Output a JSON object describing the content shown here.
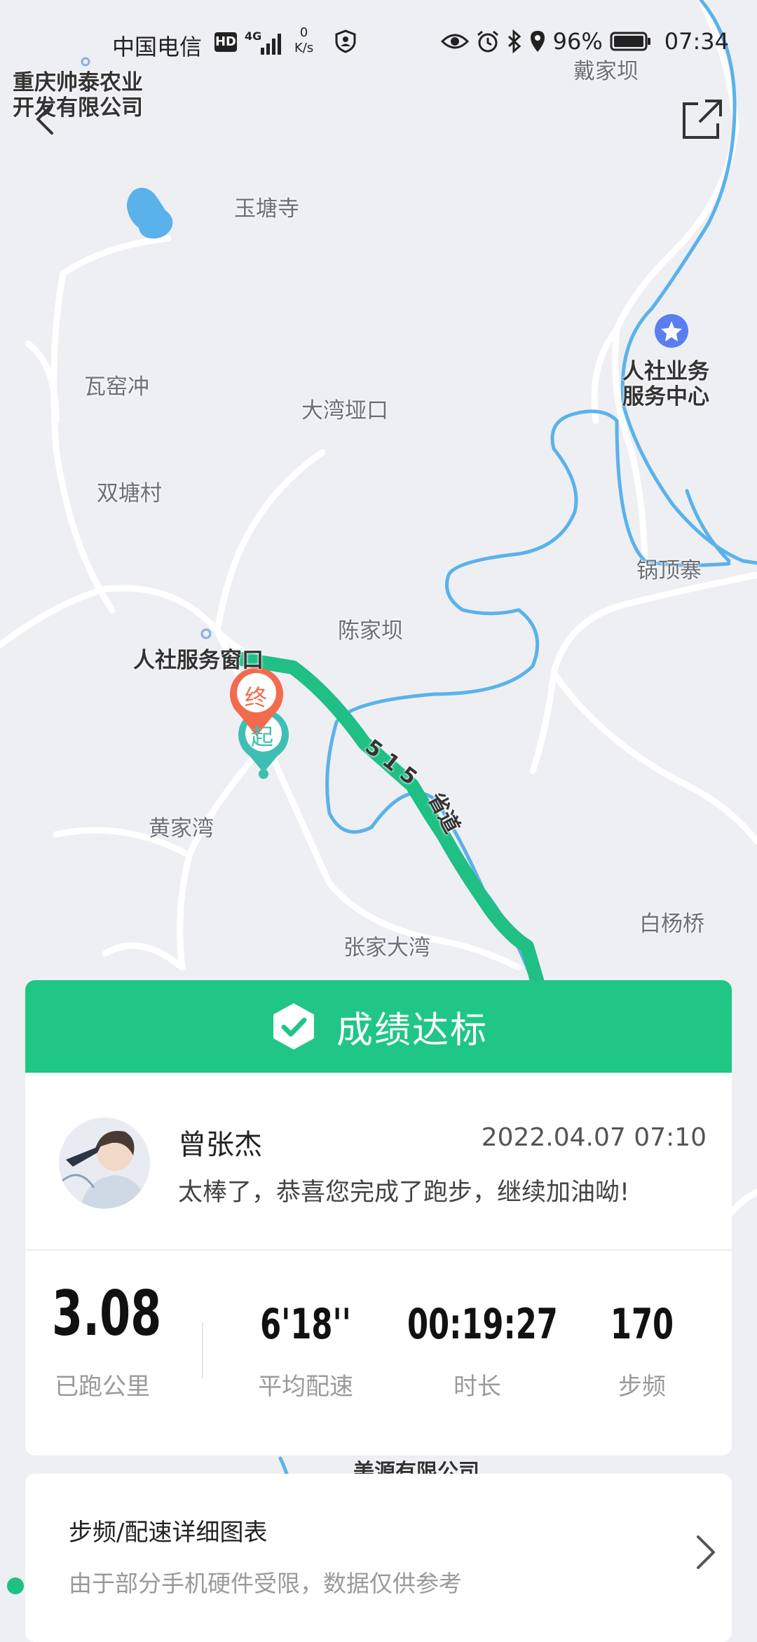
{
  "status_bar": {
    "carrier": "中国电信",
    "hd": "HD",
    "network": "4G",
    "speed_value": "0",
    "speed_unit": "K/s",
    "battery": "96%",
    "time": "07:34"
  },
  "map": {
    "labels": {
      "company": "重庆帅泰农业\n开发有限公司",
      "daijiaba": "戴家坝",
      "yutangsi": "玉塘寺",
      "waoyaochong": "瓦窑冲",
      "dawanyakou": "大湾垭口",
      "shuangtangcun": "双塘村",
      "renshe_center": "人社业务\n服务中心",
      "guodingzhai": "锅顶寨",
      "chenjiaba": "陈家坝",
      "renshe_window": "人社服务窗口",
      "huangjiawan": "黄家湾",
      "baiyangqiao": "白杨桥",
      "zhangjiadawan": "张家大湾",
      "road_number": "5 1 5",
      "road_name": "省道",
      "partial_company": "美源有限公司"
    },
    "markers": {
      "end": "终",
      "start": "起"
    },
    "colors": {
      "route": "#1fbf85",
      "river": "#5ab2ea",
      "road": "#ffffff",
      "land": "#eeeff3"
    }
  },
  "result": {
    "title": "成绩达标",
    "user_name": "曾张杰",
    "datetime": "2022.04.07 07:10",
    "message": "太棒了，恭喜您完成了跑步，继续加油呦!",
    "stats": [
      {
        "value": "3.08",
        "label": "已跑公里"
      },
      {
        "value": "6'18''",
        "label": "平均配速"
      },
      {
        "value": "00:19:27",
        "label": "时长"
      },
      {
        "value": "170",
        "label": "步频"
      }
    ],
    "accent": "#1fc685"
  },
  "detail": {
    "title": "步频/配速详细图表",
    "subtitle": "由于部分手机硬件受限，数据仅供参考"
  }
}
